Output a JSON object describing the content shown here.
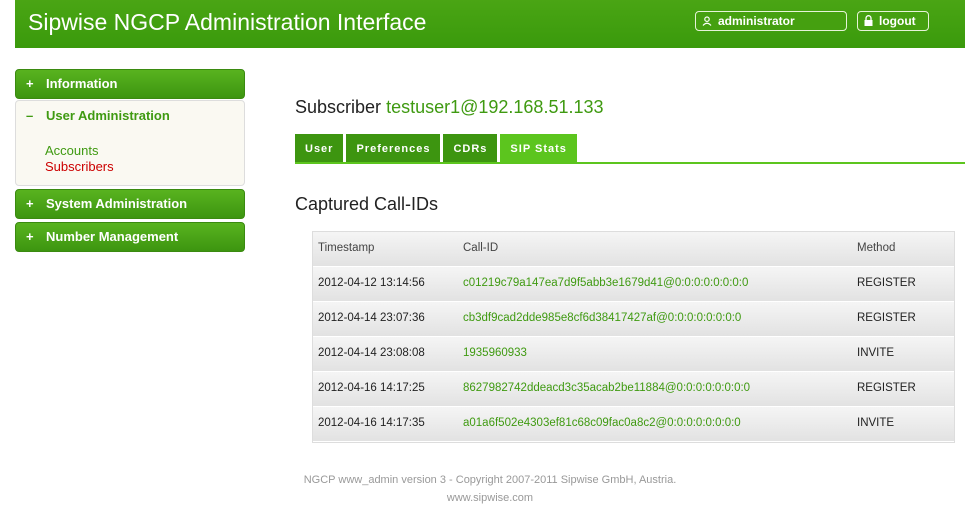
{
  "header": {
    "title": "Sipwise NGCP Administration Interface",
    "username": "administrator",
    "logout_label": "logout"
  },
  "sidebar": {
    "information": "Information",
    "user_administration": "User Administration",
    "accounts": "Accounts",
    "subscribers": "Subscribers",
    "system_administration": "System Administration",
    "number_management": "Number Management",
    "plus_sign": "+",
    "minus_sign": "–"
  },
  "main": {
    "subscriber_label": "Subscriber",
    "subscriber_name": "testuser1@192.168.51.133",
    "tabs": [
      "User",
      "Preferences",
      "CDRs",
      "SIP Stats"
    ],
    "section_title": "Captured Call-IDs",
    "columns": [
      "Timestamp",
      "Call-ID",
      "Method"
    ],
    "rows": [
      {
        "timestamp": "2012-04-12 13:14:56",
        "call_id": "c01219c79a147ea7d9f5abb3e1679d41@0:0:0:0:0:0:0:0",
        "method": "REGISTER"
      },
      {
        "timestamp": "2012-04-14 23:07:36",
        "call_id": "cb3df9cad2dde985e8cf6d38417427af@0:0:0:0:0:0:0:0",
        "method": "REGISTER"
      },
      {
        "timestamp": "2012-04-14 23:08:08",
        "call_id": "1935960933",
        "method": "INVITE"
      },
      {
        "timestamp": "2012-04-16 14:17:25",
        "call_id": "8627982742ddeacd3c35acab2be11884@0:0:0:0:0:0:0:0",
        "method": "REGISTER"
      },
      {
        "timestamp": "2012-04-16 14:17:35",
        "call_id": "a01a6f502e4303ef81c68c09fac0a8c2@0:0:0:0:0:0:0:0",
        "method": "INVITE"
      }
    ]
  },
  "footer": {
    "line1": "NGCP www_admin version 3 - Copyright 2007-2011 Sipwise GmbH, Austria.",
    "line2": "www.sipwise.com"
  },
  "colors": {
    "brand_green": "#3d9510",
    "active_tab": "#5cc51e",
    "active_link": "#cc0000"
  },
  "icons": {
    "user": "user-icon",
    "lock": "lock-icon"
  }
}
